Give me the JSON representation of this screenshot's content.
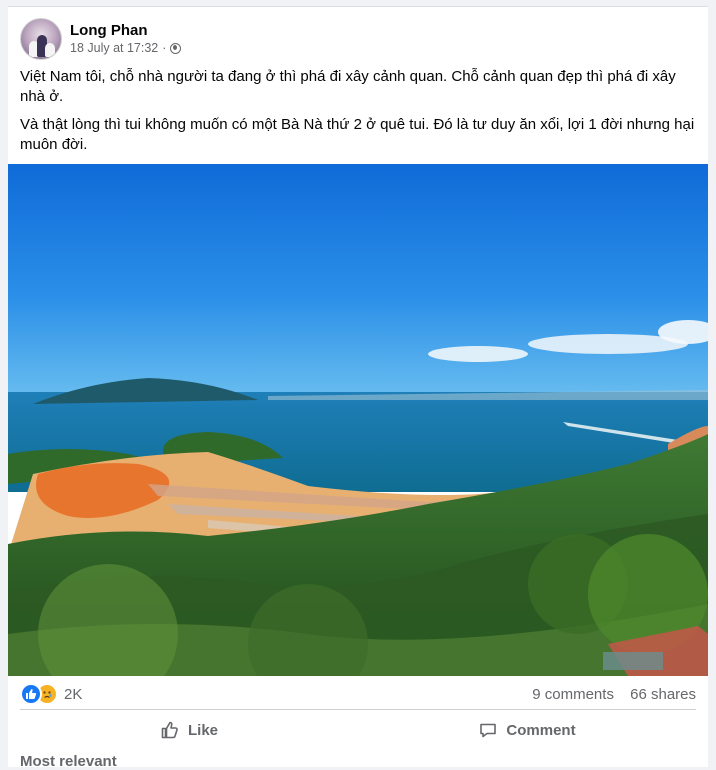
{
  "post": {
    "author": "Long Phan",
    "timestamp": "18 July at 17:32",
    "separator": "·",
    "privacy_icon": "globe-icon",
    "paragraphs": [
      "Việt Nam tôi, chỗ nhà người ta đang ở thì phá đi xây cảnh quan. Chỗ cảnh quan đẹp thì phá đi xây nhà ở.",
      "Và thật lòng thì tui không muốn có một Bà Nà thứ 2 ở quê tui. Đó là tư duy ăn xổi, lợi 1 đời nhưng hại muôn đời."
    ]
  },
  "stats": {
    "reaction_icons": [
      "like-icon",
      "sad-icon"
    ],
    "reaction_count": "2K",
    "comments": "9 comments",
    "shares": "66 shares"
  },
  "actions": {
    "like_label": "Like",
    "comment_label": "Comment"
  },
  "comments_section": {
    "sort_label": "Most relevant"
  },
  "colors": {
    "like_blue": "#1877f2",
    "sad_yellow": "#f7b125",
    "secondary_text": "#65676b"
  }
}
